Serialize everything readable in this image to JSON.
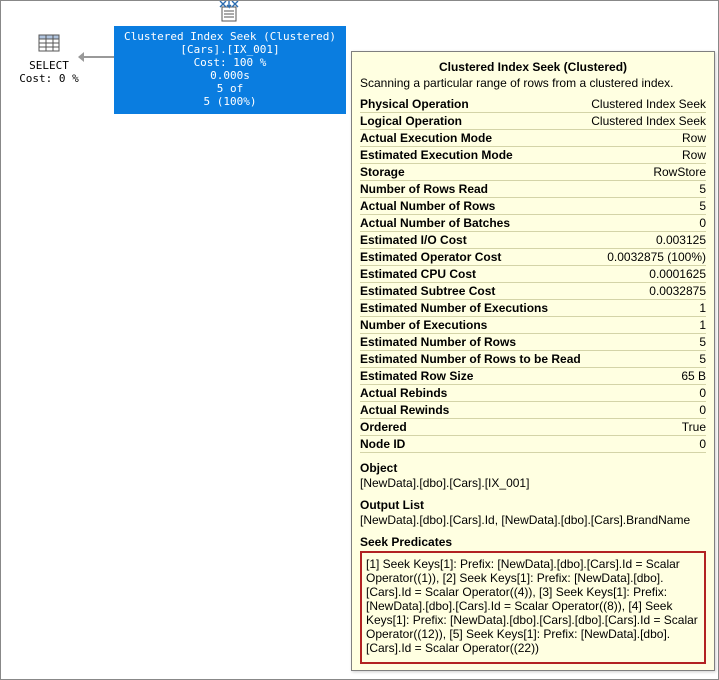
{
  "plan": {
    "select": {
      "label": "SELECT",
      "cost": "Cost: 0 %"
    },
    "seek_node": {
      "line1": "Clustered Index Seek (Clustered)",
      "line2": "[Cars].[IX_001]",
      "line3": "Cost: 100 %",
      "line4": "0.000s",
      "line5": "5 of",
      "line6": "5 (100%)"
    }
  },
  "tooltip": {
    "title": "Clustered Index Seek (Clustered)",
    "desc": "Scanning a particular range of rows from a clustered index.",
    "rows": [
      {
        "k": "Physical Operation",
        "v": "Clustered Index Seek"
      },
      {
        "k": "Logical Operation",
        "v": "Clustered Index Seek"
      },
      {
        "k": "Actual Execution Mode",
        "v": "Row"
      },
      {
        "k": "Estimated Execution Mode",
        "v": "Row"
      },
      {
        "k": "Storage",
        "v": "RowStore"
      },
      {
        "k": "Number of Rows Read",
        "v": "5"
      },
      {
        "k": "Actual Number of Rows",
        "v": "5"
      },
      {
        "k": "Actual Number of Batches",
        "v": "0"
      },
      {
        "k": "Estimated I/O Cost",
        "v": "0.003125"
      },
      {
        "k": "Estimated Operator Cost",
        "v": "0.0032875 (100%)"
      },
      {
        "k": "Estimated CPU Cost",
        "v": "0.0001625"
      },
      {
        "k": "Estimated Subtree Cost",
        "v": "0.0032875"
      },
      {
        "k": "Estimated Number of Executions",
        "v": "1"
      },
      {
        "k": "Number of Executions",
        "v": "1"
      },
      {
        "k": "Estimated Number of Rows",
        "v": "5"
      },
      {
        "k": "Estimated Number of Rows to be Read",
        "v": "5"
      },
      {
        "k": "Estimated Row Size",
        "v": "65 B"
      },
      {
        "k": "Actual Rebinds",
        "v": "0"
      },
      {
        "k": "Actual Rewinds",
        "v": "0"
      },
      {
        "k": "Ordered",
        "v": "True"
      },
      {
        "k": "Node ID",
        "v": "0"
      }
    ],
    "object_h": "Object",
    "object_v": "[NewData].[dbo].[Cars].[IX_001]",
    "output_h": "Output List",
    "output_v": "[NewData].[dbo].[Cars].Id, [NewData].[dbo].[Cars].BrandName",
    "seek_h": "Seek Predicates",
    "seek_v": "[1] Seek Keys[1]: Prefix: [NewData].[dbo].[Cars].Id = Scalar Operator((1)), [2] Seek Keys[1]: Prefix: [NewData].[dbo].[Cars].Id = Scalar Operator((4)), [3] Seek Keys[1]: Prefix: [NewData].[dbo].[Cars].Id = Scalar Operator((8)), [4] Seek Keys[1]: Prefix: [NewData].[dbo].[Cars].[dbo].[Cars].Id = Scalar Operator((12)), [5] Seek Keys[1]: Prefix: [NewData].[dbo].[Cars].Id = Scalar Operator((22))"
  }
}
